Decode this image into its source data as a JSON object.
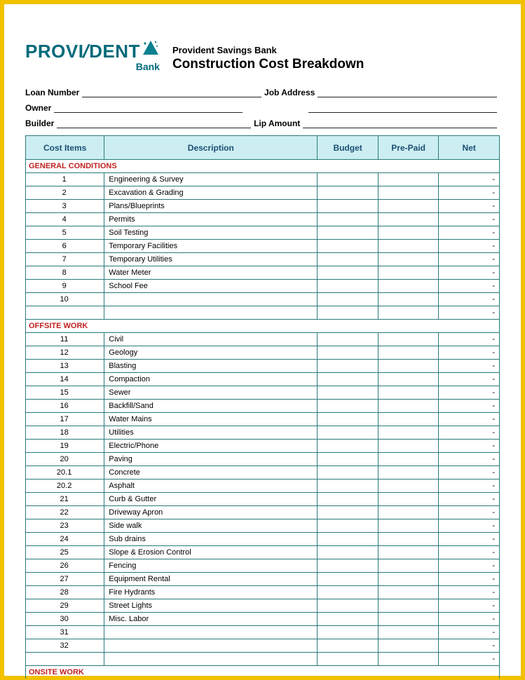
{
  "logo": {
    "brand_part1": "PROV",
    "brand_i": "I",
    "brand_part2": "DENT",
    "sub": "Bank"
  },
  "header": {
    "bank_name": "Provident Savings Bank",
    "title": "Construction Cost Breakdown"
  },
  "fields": {
    "loan_number": "Loan Number",
    "job_address": "Job Address",
    "owner": "Owner",
    "builder": "Builder",
    "lip_amount": "Lip Amount"
  },
  "table": {
    "headers": {
      "cost_items": "Cost  Items",
      "description": "Description",
      "budget": "Budget",
      "pre_paid": "Pre-Paid",
      "net": "Net"
    },
    "sections": [
      {
        "title": "GENERAL CONDITIONS",
        "rows": [
          {
            "num": "1",
            "desc": "Engineering & Survey",
            "net": "-"
          },
          {
            "num": "2",
            "desc": "Excavation & Grading",
            "net": "-"
          },
          {
            "num": "3",
            "desc": "Plans/Blueprints",
            "net": "-"
          },
          {
            "num": "4",
            "desc": "Permits",
            "net": "-"
          },
          {
            "num": "5",
            "desc": "Soil Testing",
            "net": "-"
          },
          {
            "num": "6",
            "desc": "Temporary Facilities",
            "net": "-"
          },
          {
            "num": "7",
            "desc": "Temporary Utilities",
            "net": "-"
          },
          {
            "num": "8",
            "desc": "Water Meter",
            "net": "-"
          },
          {
            "num": "9",
            "desc": "School Fee",
            "net": "-"
          },
          {
            "num": "10",
            "desc": "",
            "net": "-"
          }
        ],
        "subtotal": {
          "net": "-"
        }
      },
      {
        "title": "OFFSITE WORK",
        "rows": [
          {
            "num": "11",
            "desc": "Civil",
            "net": "-"
          },
          {
            "num": "12",
            "desc": "Geology",
            "net": "-"
          },
          {
            "num": "13",
            "desc": "Blasting",
            "net": "-"
          },
          {
            "num": "14",
            "desc": "Compaction",
            "net": "-"
          },
          {
            "num": "15",
            "desc": "Sewer",
            "net": "-"
          },
          {
            "num": "16",
            "desc": "Backfill/Sand",
            "net": "-"
          },
          {
            "num": "17",
            "desc": "Water Mains",
            "net": "-"
          },
          {
            "num": "18",
            "desc": "Utilities",
            "net": "-"
          },
          {
            "num": "19",
            "desc": "Electric/Phone",
            "net": "-"
          },
          {
            "num": "20",
            "desc": "Paving",
            "net": "-"
          },
          {
            "num": "20.1",
            "desc": "Concrete",
            "net": "-"
          },
          {
            "num": "20.2",
            "desc": "Asphalt",
            "net": "-"
          },
          {
            "num": "21",
            "desc": "Curb & Gutter",
            "net": "-"
          },
          {
            "num": "22",
            "desc": "Driveway Apron",
            "net": "-"
          },
          {
            "num": "23",
            "desc": "Side walk",
            "net": "-"
          },
          {
            "num": "24",
            "desc": "Sub drains",
            "net": "-"
          },
          {
            "num": "25",
            "desc": "Slope & Erosion Control",
            "net": "-"
          },
          {
            "num": "26",
            "desc": "Fencing",
            "net": "-"
          },
          {
            "num": "27",
            "desc": "Equipment Rental",
            "net": "-"
          },
          {
            "num": "28",
            "desc": "Fire Hydrants",
            "net": "-"
          },
          {
            "num": "29",
            "desc": "Street Lights",
            "net": "-"
          },
          {
            "num": "30",
            "desc": "Misc. Labor",
            "net": "-"
          },
          {
            "num": "31",
            "desc": "",
            "net": "-"
          },
          {
            "num": "32",
            "desc": "",
            "net": "-"
          }
        ],
        "subtotal": {
          "net": "-"
        }
      },
      {
        "title": "ONSITE WORK",
        "rows": []
      }
    ]
  }
}
